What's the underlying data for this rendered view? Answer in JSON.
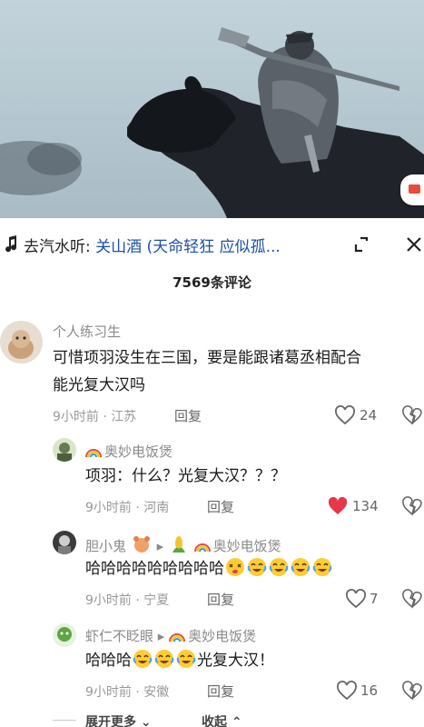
{
  "music": {
    "source": "去汽水听:",
    "song": "关山酒 (天命轻狂 应似孤..."
  },
  "comment_count": "7569条评论",
  "comments": [
    {
      "user": "个人练习生",
      "text_line1": "可惜项羽没生在三国，要是能跟诸葛丞相配合",
      "text_line2": "能光复大汉吗",
      "meta": "9小时前 · 江苏",
      "reply": "回复",
      "likes": "24"
    }
  ],
  "replies": [
    {
      "user": "奥妙电饭煲",
      "text": "项羽：什么？光复大汉？？？",
      "meta": "9小时前 · 河南",
      "reply": "回复",
      "likes": "134",
      "liked": true
    },
    {
      "user": "胆小鬼",
      "reply_to": "奥妙电饭煲",
      "text": "哈哈哈哈哈哈哈哈哈",
      "meta": "9小时前 · 宁夏",
      "reply": "回复",
      "likes": "7"
    },
    {
      "user": "虾仁不眨眼",
      "reply_to": "奥妙电饭煲",
      "text_prefix": "哈哈哈",
      "text_suffix": "光复大汉！",
      "meta": "9小时前 · 安徽",
      "reply": "回复",
      "likes": "16"
    }
  ],
  "footer": {
    "expand": "展开更多",
    "collapse": "收起"
  },
  "colors": {
    "link_blue": "#1d4fa8",
    "liked_red": "#e8374a"
  }
}
